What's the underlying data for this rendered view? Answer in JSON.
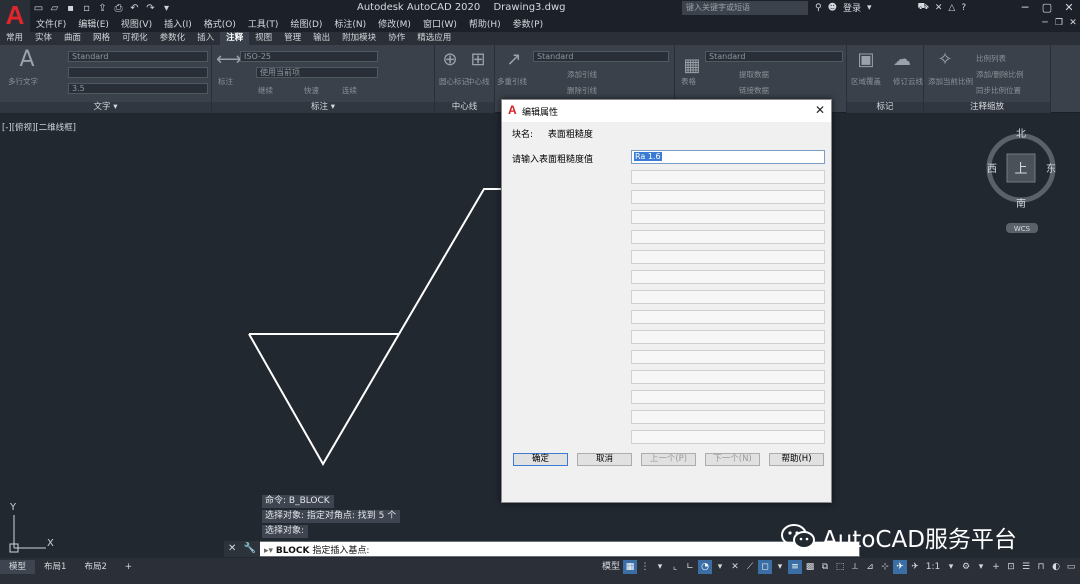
{
  "app": {
    "logo": "A",
    "product": "Autodesk AutoCAD 2020",
    "file": "Drawing3.dwg",
    "search_placeholder": "键入关键字或短语",
    "login": "登录"
  },
  "menu": [
    "文件(F)",
    "编辑(E)",
    "视图(V)",
    "插入(I)",
    "格式(O)",
    "工具(T)",
    "绘图(D)",
    "标注(N)",
    "修改(M)",
    "窗口(W)",
    "帮助(H)",
    "参数(P)"
  ],
  "ribbon_tabs": [
    "常用",
    "实体",
    "曲面",
    "网格",
    "可视化",
    "参数化",
    "插入",
    "注释",
    "视图",
    "管理",
    "输出",
    "附加模块",
    "协作",
    "精选应用"
  ],
  "ribbon_active_tab": "注释",
  "ribbon": {
    "text_panel": {
      "title": "文字 ▾",
      "big_label": "多行文字",
      "style": "Standard",
      "height": "3.5"
    },
    "dim_panel": {
      "title": "标注 ▾",
      "style": "ISO-25",
      "layer": "使用当前项",
      "big_label": "标注",
      "items": [
        "继续",
        "快速",
        "连续"
      ]
    },
    "centerline_panel": {
      "title": "中心线",
      "items": [
        "圆心标记",
        "中心线"
      ]
    },
    "leader_panel": {
      "style": "Standard",
      "items": [
        "多重引线",
        "添加引线",
        "删除引线"
      ]
    },
    "table_panel": {
      "style": "Standard",
      "big_label": "表格",
      "items": [
        "提取数据",
        "链接数据"
      ]
    },
    "markup_panel": {
      "title": "标记",
      "items": [
        "区域覆盖",
        "修订云线"
      ]
    },
    "scale_panel": {
      "title": "注释缩放",
      "big_label": "添加当前比例",
      "items": [
        "比例列表",
        "添加/删除比例",
        "同步比例位置"
      ]
    }
  },
  "viewport": {
    "label": "[-][俯视][二维线框]"
  },
  "viewcube": {
    "north": "北",
    "south": "南",
    "east": "东",
    "west": "西",
    "top": "上",
    "ucs": "WCS"
  },
  "ucs_icon": {
    "x": "X",
    "y": "Y"
  },
  "command_history": [
    "命令: B_BLOCK",
    "选择对象: 指定对角点: 找到 5 个",
    "选择对象:"
  ],
  "command_line": {
    "command": "BLOCK",
    "prompt": "指定插入基点:"
  },
  "layout_tabs": [
    "模型",
    "布局1",
    "布局2"
  ],
  "layout_add": "+",
  "status_model": "模型",
  "status_scale": "1:1",
  "watermark": {
    "text": "AutoCAD服务平台"
  },
  "dialog": {
    "title": "编辑属性",
    "block_name_label": "块名:",
    "block_name": "表面粗糙度",
    "prompt_label": "请输入表面粗糙度值",
    "value": "Ra 1.6",
    "empty_rows": 14,
    "buttons": {
      "ok": "确定",
      "cancel": "取消",
      "prev": "上一个(P)",
      "next": "下一个(N)",
      "help": "帮助(H)"
    }
  }
}
